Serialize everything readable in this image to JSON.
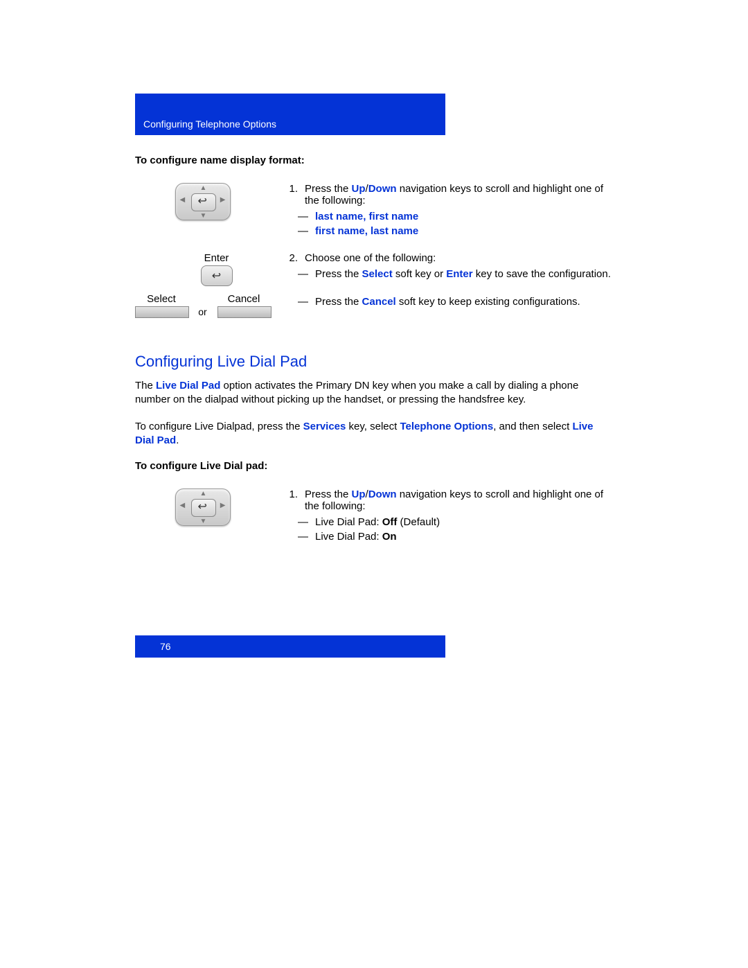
{
  "header": {
    "title": "Configuring Telephone Options"
  },
  "section1": {
    "title": "To configure name display format:",
    "step1": {
      "num": "1.",
      "text_a": "Press the ",
      "up": "Up",
      "slash": "/",
      "down": "Down",
      "text_b": " navigation keys to scroll and highlight one of the following:",
      "opt1": "last name, first name",
      "opt2": "first name, last name",
      "dash": "—"
    },
    "enter_label": "Enter",
    "step2": {
      "num": "2.",
      "text": "Choose one of the following:",
      "dash": "—",
      "a_pre": "Press the ",
      "select": "Select",
      "a_mid": " soft key or ",
      "enter": "Enter",
      "a_post": " key to save the configuration.",
      "b_pre": "Press the ",
      "cancel": "Cancel",
      "b_post": " soft key to keep existing configurations."
    },
    "softkeys": {
      "select": "Select",
      "or": "or",
      "cancel": "Cancel"
    }
  },
  "section2": {
    "heading": "Configuring Live Dial Pad",
    "para1_a": "The ",
    "live_dial_pad": "Live Dial Pad",
    "para1_b": " option activates the Primary DN key when you make a call by dialing a phone number on the dialpad without picking up the handset, or pressing the handsfree key.",
    "para2_a": "To configure Live Dialpad, press the ",
    "services": "Services",
    "para2_b": " key, select ",
    "telephone_options": "Telephone Options",
    "para2_c": ", and then select ",
    "live_dial_pad2": "Live Dial Pad",
    "period": ".",
    "title": "To configure Live Dial pad:",
    "step1": {
      "num": "1.",
      "text_a": "Press the ",
      "up": "Up",
      "slash": "/",
      "down": "Down",
      "text_b": " navigation keys to scroll and highlight one of the following:",
      "dash": "—",
      "opt1_a": "Live Dial Pad: ",
      "off": "Off",
      "opt1_b": " (Default)",
      "opt2_a": "Live Dial Pad: ",
      "on": "On"
    }
  },
  "footer": {
    "page": "76"
  }
}
